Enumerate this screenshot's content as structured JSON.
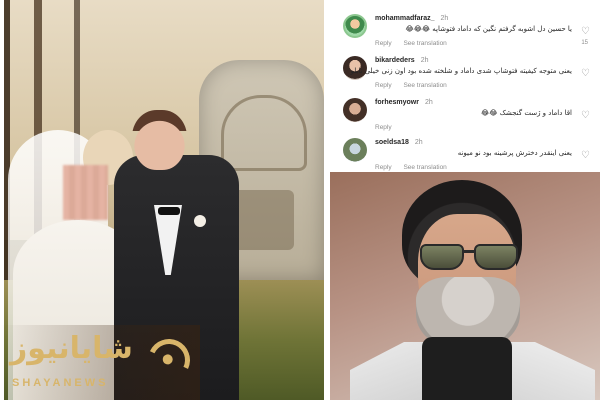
{
  "comments": [
    {
      "username": "mohammadfaraz_",
      "time": "2h",
      "text": "یا حسین دل اشوبه گرفتم نگین که داماد فتوشاپه 😂😂😂",
      "reply_label": "Reply",
      "translation_label": "See translation",
      "likes": "15"
    },
    {
      "username": "bikardeders",
      "time": "2h",
      "text": "یعنی متوجه کیفیته فتوشاپ شدی داماد و شلخته شده بود اون زنی خیلی تابلو",
      "reply_label": "Reply",
      "translation_label": "See translation",
      "likes": ""
    },
    {
      "username": "forhesmyowr",
      "time": "2h",
      "text": "اقا داماد و ژست گنجشک 😂😂",
      "reply_label": "Reply",
      "translation_label": "",
      "likes": ""
    },
    {
      "username": "soeldsa18",
      "time": "2h",
      "text": "یعنی اینقدر دخترش پرشینه بود نو میونه",
      "reply_label": "Reply",
      "translation_label": "See translation",
      "likes": ""
    }
  ],
  "icons": {
    "like": "heart-icon"
  },
  "watermark": {
    "main": "شایانیوز",
    "sub": "SHAYANEWS"
  },
  "colors": {
    "watermark": "#d8b56a",
    "text": "#262626",
    "muted": "#8e8e8e"
  }
}
